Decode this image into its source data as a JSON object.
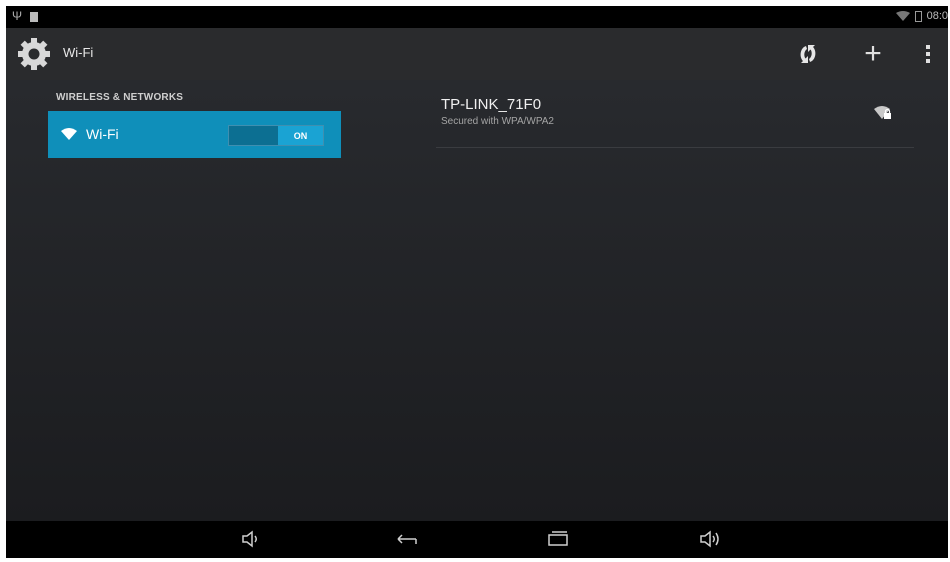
{
  "status_bar": {
    "time": "08:0",
    "icons": [
      "usb-icon",
      "notification-icon",
      "wifi-signal-icon",
      "battery-icon"
    ]
  },
  "action_bar": {
    "title": "Wi-Fi",
    "icon": "settings-gear-icon",
    "actions": [
      "wps-icon",
      "add-network-icon",
      "overflow-menu-icon"
    ],
    "add_glyph": "+"
  },
  "sidebar": {
    "section_header": "WIRELESS & NETWORKS",
    "items": [
      {
        "label": "Wi-Fi",
        "icon": "wifi-icon",
        "toggle": "ON",
        "selected": true
      }
    ]
  },
  "networks": [
    {
      "ssid": "TP-LINK_71F0",
      "security": "Secured with WPA/WPA2",
      "icon": "wifi-locked-icon"
    }
  ],
  "nav_bar": {
    "buttons": [
      "volume-down-icon",
      "back-icon",
      "recent-apps-icon",
      "volume-up-icon"
    ]
  },
  "colors": {
    "accent": "#0f8fba",
    "action_bar": "#2a2b2d",
    "background": "#1b1c1f"
  }
}
